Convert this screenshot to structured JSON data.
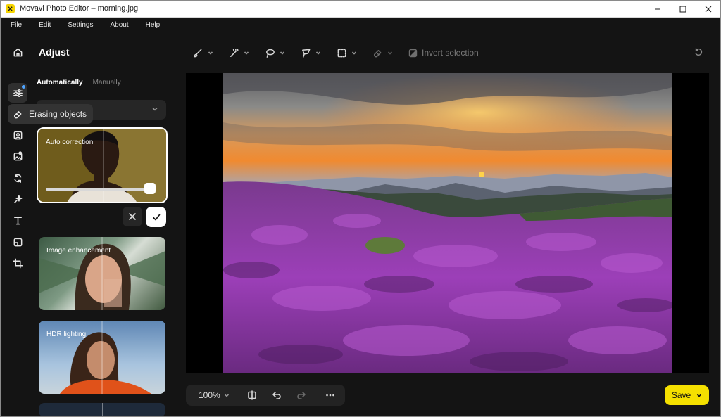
{
  "window": {
    "title": "Movavi Photo Editor – morning.jpg"
  },
  "menu": [
    "File",
    "Edit",
    "Settings",
    "About",
    "Help"
  ],
  "panel": {
    "title": "Adjust",
    "tabs": [
      {
        "label": "Automatically",
        "active": true
      },
      {
        "label": "Manually",
        "active": false
      }
    ],
    "tooltip": "Erasing objects",
    "cards": [
      {
        "label": "Auto correction",
        "slider_level": 1.0,
        "selected": true
      },
      {
        "label": "Image enhancement"
      },
      {
        "label": "HDR lighting"
      }
    ]
  },
  "toolbar": {
    "invert_selection": "Invert selection",
    "tools": [
      "brush-icon",
      "magic-wand-icon",
      "lasso-icon",
      "polygonal-lasso-icon",
      "rect-select-icon",
      "eraser-icon"
    ]
  },
  "bottom": {
    "zoom": "100%",
    "save": "Save"
  },
  "colors": {
    "accent": "#f5e000",
    "badge": "#4ea4ff",
    "panel_bg": "#141414"
  }
}
